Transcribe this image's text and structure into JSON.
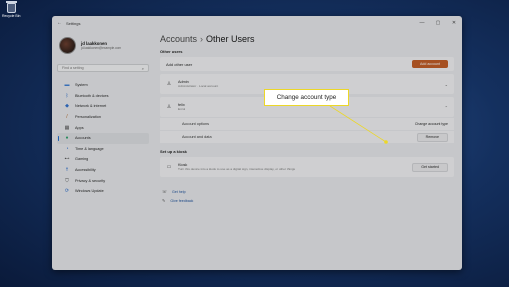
{
  "desktop": {
    "recycle_bin_label": "Recycle Bin"
  },
  "window": {
    "title": "Settings",
    "controls": [
      "—",
      "▢",
      "✕"
    ]
  },
  "profile": {
    "name": "jd laakkonen",
    "email": "jd.laakkonen@example.com"
  },
  "search": {
    "placeholder": "Find a setting"
  },
  "nav": [
    {
      "label": "System",
      "icon": "monitor-icon"
    },
    {
      "label": "Bluetooth & devices",
      "icon": "bluetooth-icon"
    },
    {
      "label": "Network & internet",
      "icon": "wifi-icon"
    },
    {
      "label": "Personalization",
      "icon": "brush-icon"
    },
    {
      "label": "Apps",
      "icon": "apps-icon"
    },
    {
      "label": "Accounts",
      "icon": "accounts-icon",
      "active": true
    },
    {
      "label": "Time & language",
      "icon": "clock-icon"
    },
    {
      "label": "Gaming",
      "icon": "gamepad-icon"
    },
    {
      "label": "Accessibility",
      "icon": "accessibility-icon"
    },
    {
      "label": "Privacy & security",
      "icon": "shield-icon"
    },
    {
      "label": "Windows Update",
      "icon": "update-icon"
    }
  ],
  "breadcrumb": {
    "parent": "Accounts",
    "separator": "›",
    "current": "Other Users"
  },
  "other_users": {
    "heading": "Other users",
    "add_label": "Add other user",
    "add_button": "Add account",
    "users": [
      {
        "name": "Admin",
        "role": "Administrator · Local account"
      },
      {
        "name": "felix",
        "role": "Enrol"
      }
    ],
    "account_options_label": "Account options",
    "change_type_button": "Change account type",
    "account_data_label": "Account and data",
    "remove_button": "Remove"
  },
  "kiosk": {
    "heading": "Set up a kiosk",
    "title": "Kiosk",
    "description": "Turn this device into a kiosk to use as a digital sign, interactive display, or other things",
    "button": "Get started"
  },
  "help": {
    "get_help": "Get help",
    "give_feedback": "Give feedback"
  },
  "callout": {
    "text": "Change account type",
    "color": "#ecd728"
  }
}
